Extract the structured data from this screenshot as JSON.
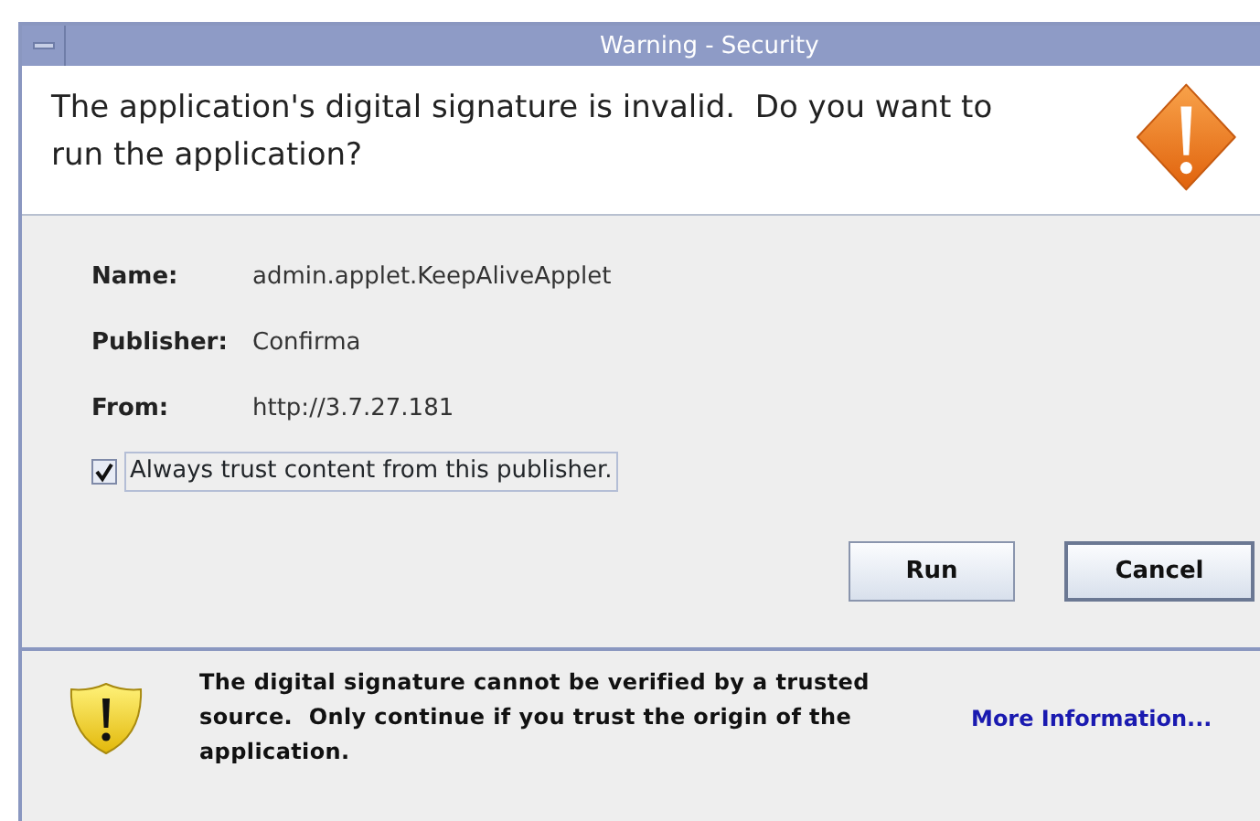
{
  "window": {
    "title": "Warning - Security"
  },
  "header": {
    "message": "The application's digital signature is invalid.  Do you want to run the application?"
  },
  "details": [
    {
      "label": "Name:",
      "value": "admin.applet.KeepAliveApplet"
    },
    {
      "label": "Publisher:",
      "value": "Confirma"
    },
    {
      "label": "From:",
      "value": "http://3.7.27.181"
    }
  ],
  "trust_checkbox": {
    "label": "Always trust content from this publisher.",
    "checked": true
  },
  "buttons": [
    {
      "label": "Run",
      "default": false
    },
    {
      "label": "Cancel",
      "default": true
    }
  ],
  "footer": {
    "message": "The digital signature cannot be verified by a trusted source.  Only continue if you trust the origin of the application.",
    "link": "More Information..."
  }
}
